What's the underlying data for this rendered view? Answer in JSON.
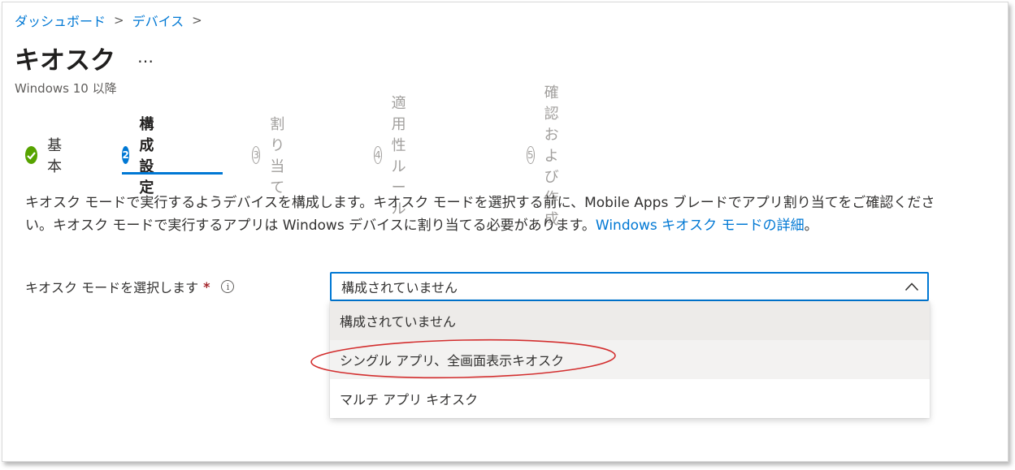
{
  "breadcrumb": {
    "items": [
      "ダッシュボード",
      "デバイス"
    ]
  },
  "page": {
    "title": "キオスク",
    "more_label": "…",
    "subtitle": "Windows 10 以降"
  },
  "steps": [
    {
      "number": "✓",
      "label": "基本",
      "state": "done"
    },
    {
      "number": "2",
      "label": "構成設定",
      "state": "active"
    },
    {
      "number": "3",
      "label": "割り当て",
      "state": "todo"
    },
    {
      "number": "4",
      "label": "適用性ルール",
      "state": "todo"
    },
    {
      "number": "5",
      "label": "確認および作成",
      "state": "todo"
    }
  ],
  "description": {
    "text": "キオスク モードで実行するようデバイスを構成します。キオスク モードを選択する前に、Mobile Apps ブレードでアプリ割り当てをご確認ください。キオスク モードで実行するアプリは Windows デバイスに割り当てる必要があります。",
    "link": "Windows キオスク モードの詳細",
    "trailing": "。"
  },
  "field": {
    "label": "キオスク モードを選択します",
    "required_mark": "*",
    "info_icon": "i",
    "selected_value": "構成されていません"
  },
  "dropdown": {
    "options": [
      "構成されていません",
      "シングル アプリ、全画面表示キオスク",
      "マルチ アプリ キオスク"
    ]
  },
  "colors": {
    "accent": "#0078d4",
    "done": "#57a300",
    "annotation": "#d32f2f"
  }
}
